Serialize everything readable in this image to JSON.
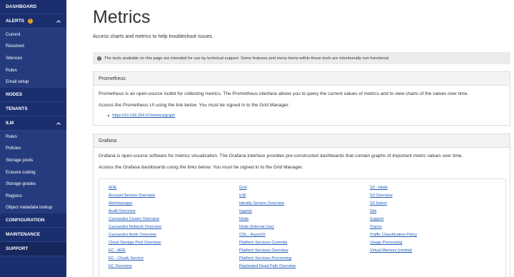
{
  "sidebar": {
    "dashboard": "DASHBOARD",
    "alerts": {
      "label": "ALERTS",
      "badge": "!",
      "items": [
        "Current",
        "Resolved",
        "Silences",
        "Rules",
        "Email setup"
      ]
    },
    "nodes": "NODES",
    "tenants": "TENANTS",
    "ilm": {
      "label": "ILM",
      "items": [
        "Rules",
        "Policies",
        "Storage pools",
        "Erasure coding",
        "Storage grades",
        "Regions",
        "Object metadata lookup"
      ]
    },
    "configuration": "CONFIGURATION",
    "maintenance": "MAINTENANCE",
    "support": "SUPPORT"
  },
  "main": {
    "title": "Metrics",
    "description": "Access charts and metrics to help troubleshoot issues.",
    "info": "The tools available on this page are intended for use by technical support. Some features and menu items within these tools are intentionally non-functional.",
    "prometheus": {
      "heading": "Prometheus",
      "text1": "Prometheus is an open-source toolkit for collecting metrics. The Prometheus interface allows you to query the current values of metrics and to view charts of the values over time.",
      "text2": "Access the Prometheus UI using the link below. You must be signed in to the Grid Manager.",
      "link": "https://10.193.204.57/metrics/graph"
    },
    "grafana": {
      "heading": "Grafana",
      "text1": "Grafana is open-source software for metrics visualization. The Grafana interface provides pre-constructed dashboards that contain graphs of important metric values over time.",
      "text2": "Access the Grafana dashboards using the links below. You must be signed in to the Grid Manager.",
      "col1": [
        "ADE",
        "Account Service Overview",
        "Alertmanager",
        "Audit Overview",
        "Cassandra Cluster Overview",
        "Cassandra Network Overview",
        "Cassandra Node Overview",
        "Cloud Storage Pool Overview",
        "EC - ADE",
        "EC - Chunk Service",
        "EC Overview"
      ],
      "col2": [
        "Grid",
        "ILM",
        "Identity Service Overview",
        "Ingests",
        "Node",
        "Node (Internal Use)",
        "OSL - AsyncIO",
        "Platform Services Commits",
        "Platform Services Overview",
        "Platform Services Processing",
        "Replicated Read Path Overview"
      ],
      "col3": [
        "S3 - Node",
        "S3 Overview",
        "S3 Select",
        "Site",
        "Support",
        "Traces",
        "Traffic Classification Policy",
        "Usage Processing",
        "Virtual Memory (vmstat)"
      ]
    }
  }
}
